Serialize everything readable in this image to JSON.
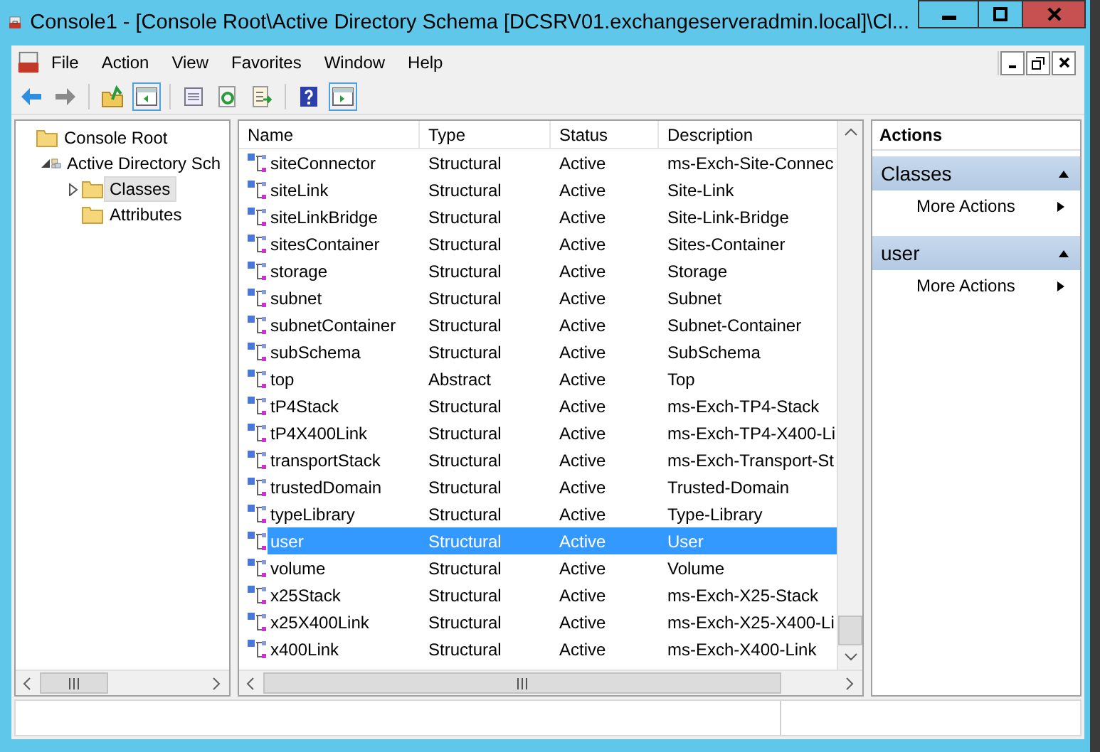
{
  "window": {
    "title": "Console1 - [Console Root\\Active Directory Schema [DCSRV01.exchangeserveradmin.local]\\Cl..."
  },
  "menu": [
    "File",
    "Action",
    "View",
    "Favorites",
    "Window",
    "Help"
  ],
  "tree": [
    {
      "label": "Console Root",
      "kind": "folder",
      "selected": false,
      "children": [
        {
          "label": "Active Directory Sch",
          "kind": "snapin",
          "selected": false,
          "expanded": true,
          "children": [
            {
              "label": "Classes",
              "kind": "folder",
              "selected": true,
              "expanded": false
            },
            {
              "label": "Attributes",
              "kind": "folder",
              "selected": false
            }
          ]
        }
      ]
    }
  ],
  "table": {
    "columns": [
      "Name",
      "Type",
      "Status",
      "Description"
    ],
    "rows": [
      {
        "name": "siteConnector",
        "type": "Structural",
        "status": "Active",
        "description": "ms-Exch-Site-Connec",
        "selected": false
      },
      {
        "name": "siteLink",
        "type": "Structural",
        "status": "Active",
        "description": "Site-Link",
        "selected": false
      },
      {
        "name": "siteLinkBridge",
        "type": "Structural",
        "status": "Active",
        "description": "Site-Link-Bridge",
        "selected": false
      },
      {
        "name": "sitesContainer",
        "type": "Structural",
        "status": "Active",
        "description": "Sites-Container",
        "selected": false
      },
      {
        "name": "storage",
        "type": "Structural",
        "status": "Active",
        "description": "Storage",
        "selected": false
      },
      {
        "name": "subnet",
        "type": "Structural",
        "status": "Active",
        "description": "Subnet",
        "selected": false
      },
      {
        "name": "subnetContainer",
        "type": "Structural",
        "status": "Active",
        "description": "Subnet-Container",
        "selected": false
      },
      {
        "name": "subSchema",
        "type": "Structural",
        "status": "Active",
        "description": "SubSchema",
        "selected": false
      },
      {
        "name": "top",
        "type": "Abstract",
        "status": "Active",
        "description": "Top",
        "selected": false
      },
      {
        "name": "tP4Stack",
        "type": "Structural",
        "status": "Active",
        "description": "ms-Exch-TP4-Stack",
        "selected": false
      },
      {
        "name": "tP4X400Link",
        "type": "Structural",
        "status": "Active",
        "description": "ms-Exch-TP4-X400-Li",
        "selected": false
      },
      {
        "name": "transportStack",
        "type": "Structural",
        "status": "Active",
        "description": "ms-Exch-Transport-St",
        "selected": false
      },
      {
        "name": "trustedDomain",
        "type": "Structural",
        "status": "Active",
        "description": "Trusted-Domain",
        "selected": false
      },
      {
        "name": "typeLibrary",
        "type": "Structural",
        "status": "Active",
        "description": "Type-Library",
        "selected": false
      },
      {
        "name": "user",
        "type": "Structural",
        "status": "Active",
        "description": "User",
        "selected": true
      },
      {
        "name": "volume",
        "type": "Structural",
        "status": "Active",
        "description": "Volume",
        "selected": false
      },
      {
        "name": "x25Stack",
        "type": "Structural",
        "status": "Active",
        "description": "ms-Exch-X25-Stack",
        "selected": false
      },
      {
        "name": "x25X400Link",
        "type": "Structural",
        "status": "Active",
        "description": "ms-Exch-X25-X400-Li",
        "selected": false
      },
      {
        "name": "x400Link",
        "type": "Structural",
        "status": "Active",
        "description": "ms-Exch-X400-Link",
        "selected": false
      }
    ]
  },
  "actions": {
    "title": "Actions",
    "sections": [
      {
        "title": "Classes",
        "items": [
          "More Actions"
        ]
      },
      {
        "title": "user",
        "items": [
          "More Actions"
        ]
      }
    ]
  }
}
